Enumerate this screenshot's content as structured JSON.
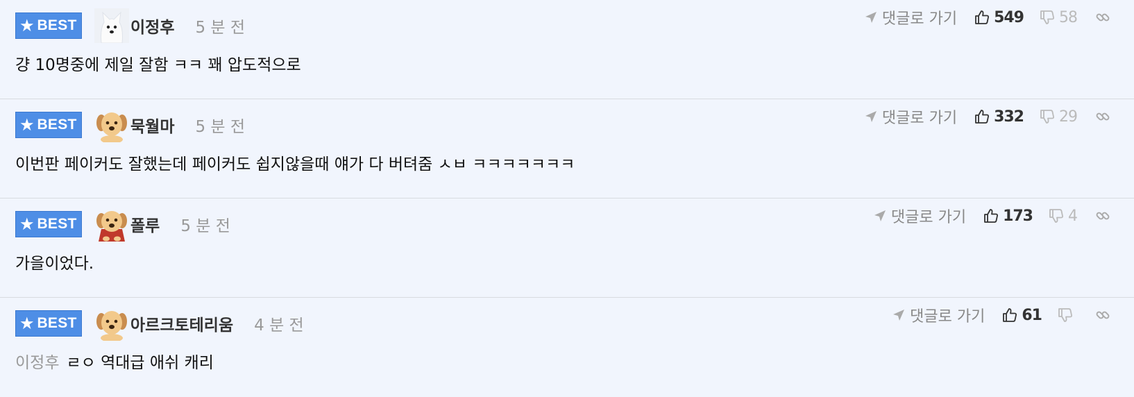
{
  "comments": [
    {
      "badge": "BEST",
      "author": "이정후",
      "avatar": "white-dog-avatar",
      "time": "5 분 전",
      "text": "걍 10명중에 제일 잘함 ㅋㅋ 꽤 압도적으로",
      "mention": "",
      "goto_label": "댓글로 가기",
      "likes": "549",
      "dislikes": "58"
    },
    {
      "badge": "BEST",
      "author": "묵월마",
      "avatar": "puppy-avatar",
      "time": "5 분 전",
      "text": "이번판 페이커도 잘했는데 페이커도 쉽지않을때 얘가 다 버텨줌 ㅅㅂ ㅋㅋㅋㅋㅋㅋㅋ",
      "mention": "",
      "goto_label": "댓글로 가기",
      "likes": "332",
      "dislikes": "29"
    },
    {
      "badge": "BEST",
      "author": "폴루",
      "avatar": "puppy-cape-avatar",
      "time": "5 분 전",
      "text": "가을이었다.",
      "mention": "",
      "goto_label": "댓글로 가기",
      "likes": "173",
      "dislikes": "4"
    },
    {
      "badge": "BEST",
      "author": "아르크토테리움",
      "avatar": "puppy-avatar",
      "time": "4 분 전",
      "text": "ㄹㅇ 역대급 애쉬 캐리",
      "mention": "이정후",
      "goto_label": "댓글로 가기",
      "likes": "61",
      "dislikes": ""
    }
  ],
  "colors": {
    "background": "#f1f5fd",
    "badge": "#4e8ee6",
    "muted": "#999999"
  }
}
